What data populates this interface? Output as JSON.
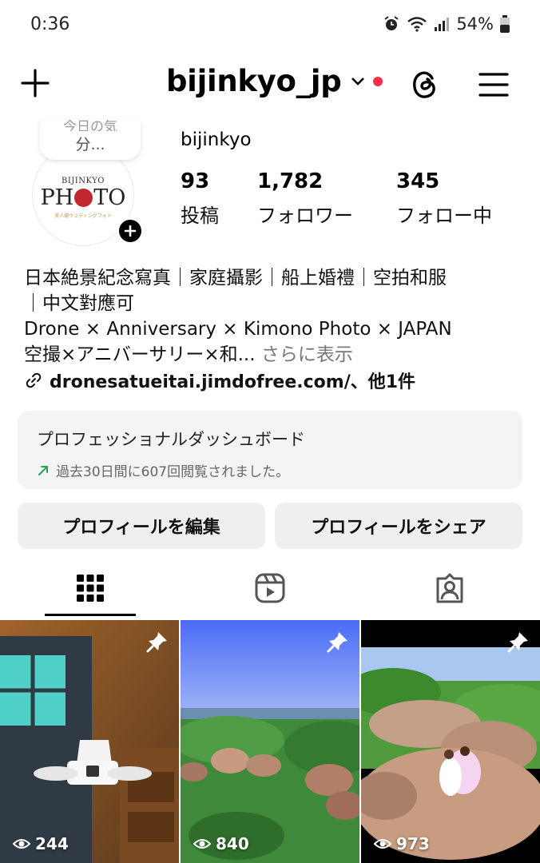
{
  "status_bar": {
    "time": "0:36",
    "battery": "54%",
    "icons": [
      "alarm-icon",
      "wifi-icon",
      "signal-icon",
      "battery-icon"
    ]
  },
  "header": {
    "username": "bijinkyo_jp",
    "notification_color": "#ff2d48"
  },
  "profile": {
    "avatar_brand_small": "BIJINKYO",
    "avatar_brand_big_left": "PH",
    "avatar_brand_big_right": "TO",
    "avatar_brand_sub": "美人鏡ウェディングフォト",
    "note_line1": "今日の気",
    "note_line2": "分...",
    "display_name": "bijinkyo",
    "stats": [
      {
        "value": "93",
        "label": "投稿"
      },
      {
        "value": "1,782",
        "label": "フォロワー"
      },
      {
        "value": "345",
        "label": "フォロー中"
      }
    ],
    "bio_line1": "日本絶景紀念寫真｜家庭攝影｜船上婚禮｜空拍和服",
    "bio_line2": "｜中文對應可",
    "bio_line3": "Drone × Anniversary × Kimono Photo × JAPAN",
    "bio_line4": "空撮×アニバーサリー×和...",
    "bio_more": "さらに表示",
    "link": "dronesatueitai.jimdofree.com/、他1件"
  },
  "dashboard": {
    "title": "プロフェッショナルダッシュボード",
    "subtitle": "過去30日間に607回閲覧されました。",
    "trend_color": "#2e9e4f"
  },
  "actions": {
    "edit": "プロフィールを編集",
    "share": "プロフィールをシェア"
  },
  "tabs": [
    "grid-icon",
    "reels-icon",
    "tagged-icon"
  ],
  "posts": [
    {
      "views": "244",
      "pinned": true
    },
    {
      "views": "840",
      "pinned": true
    },
    {
      "views": "973",
      "pinned": true
    }
  ]
}
